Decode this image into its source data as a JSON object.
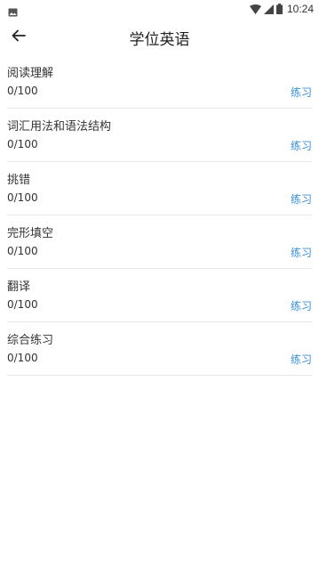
{
  "status_bar": {
    "time": "10:24",
    "icons": [
      "image-icon",
      "wifi-icon",
      "signal-icon",
      "battery-icon"
    ]
  },
  "header": {
    "title": "学位英语",
    "back_icon": "arrow-left-icon"
  },
  "items": [
    {
      "title": "阅读理解",
      "progress": "0/100",
      "action": "练习"
    },
    {
      "title": "词汇用法和语法结构",
      "progress": "0/100",
      "action": "练习"
    },
    {
      "title": "挑错",
      "progress": "0/100",
      "action": "练习"
    },
    {
      "title": "完形填空",
      "progress": "0/100",
      "action": "练习"
    },
    {
      "title": "翻译",
      "progress": "0/100",
      "action": "练习"
    },
    {
      "title": "综合练习",
      "progress": "0/100",
      "action": "练习"
    }
  ],
  "colors": {
    "accent": "#3b8fd6",
    "divider": "#e6e6e6",
    "text": "#333333"
  }
}
